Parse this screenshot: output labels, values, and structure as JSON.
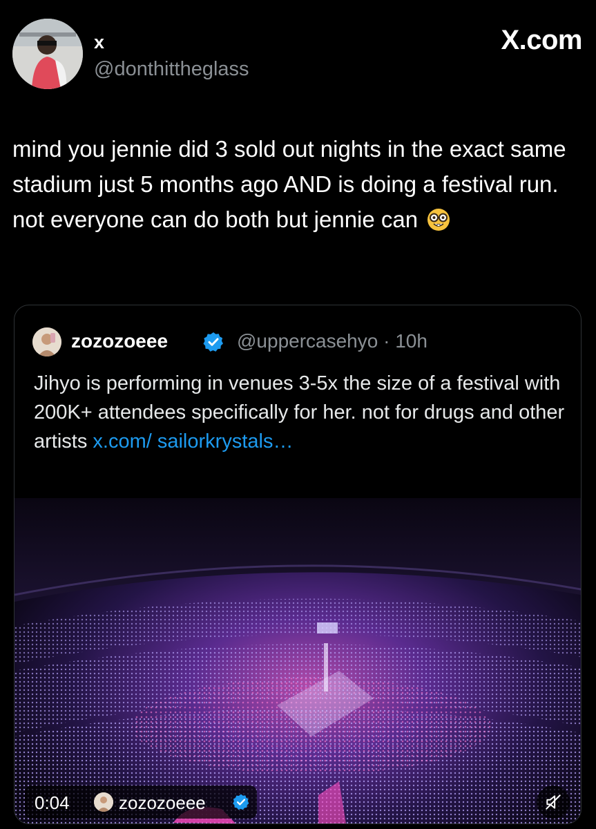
{
  "post": {
    "display_name": "x",
    "handle": "@donthittheglass",
    "brand": "X.com",
    "text": "mind you jennie did 3 sold out nights in the exact same stadium just 5 months ago AND is doing a festival run. not everyone can do both but jennie can",
    "emoji": "nerd-face-emoji"
  },
  "quote": {
    "display_name": "zozozoeee",
    "handle_time": "@uppercasehyo · 10h",
    "text": "Jihyo is performing in venues 3-5x the size of a festival with 200K+ attendees specifically for her. not for drugs and other artists ",
    "link": "x.com/ sailorkrystals…",
    "verified_color": "#1d9bf0",
    "media": {
      "time": "0:04",
      "author": "zozozoeee",
      "mute_icon": "muted-speaker-icon"
    }
  },
  "colors": {
    "background": "#000000",
    "text": "#e7e9ea",
    "muted": "#8b9095",
    "link": "#1d9bf0"
  }
}
